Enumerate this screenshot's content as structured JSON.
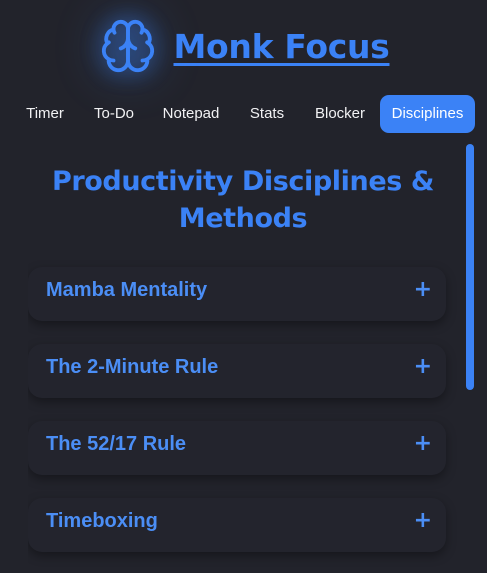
{
  "header": {
    "title": "Monk Focus",
    "logo_icon": "brain-icon"
  },
  "tabs": [
    {
      "label": "Timer",
      "active": false
    },
    {
      "label": "To-Do",
      "active": false
    },
    {
      "label": "Notepad",
      "active": false
    },
    {
      "label": "Stats",
      "active": false
    },
    {
      "label": "Blocker",
      "active": false
    },
    {
      "label": "Disciplines",
      "active": true
    }
  ],
  "disciplines": {
    "title_line1": "Productivity Disciplines &",
    "title_line2": "Methods",
    "items": [
      {
        "label": "Mamba Mentality",
        "toggle": "+"
      },
      {
        "label": "The 2-Minute Rule",
        "toggle": "+"
      },
      {
        "label": "The 52/17 Rule",
        "toggle": "+"
      },
      {
        "label": "Timeboxing",
        "toggle": "+"
      }
    ]
  },
  "colors": {
    "accent": "#3b82f6",
    "background": "#22232b",
    "card": "#23242d",
    "text": "#f2f2f4"
  }
}
